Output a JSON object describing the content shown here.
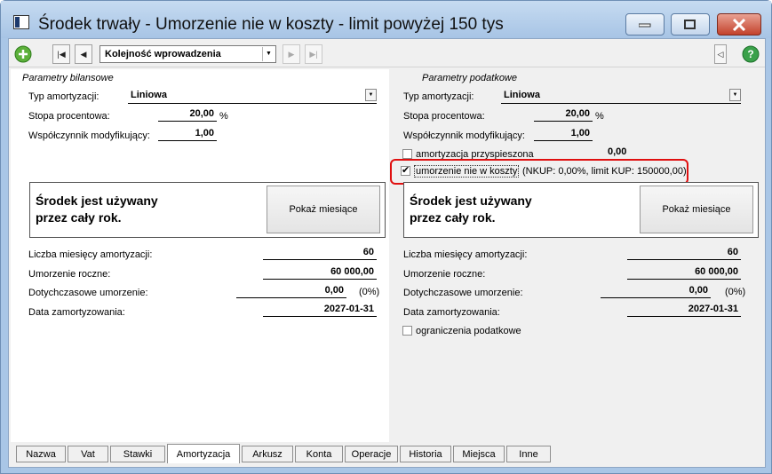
{
  "window": {
    "title": "Środek trwały - Umorzenie nie w koszty - limit powyżej 150 tys"
  },
  "toolbar": {
    "order_select": "Kolejność wprowadzenia"
  },
  "bil": {
    "header": "Parametry bilansowe",
    "typ_label": "Typ amortyzacji:",
    "typ_value": "Liniowa",
    "stopa_label": "Stopa procentowa:",
    "stopa_value": "20,00",
    "stopa_unit": "%",
    "wsp_label": "Współczynnik modyfikujący:",
    "wsp_value": "1,00",
    "used_line1": "Środek jest używany",
    "used_line2": "przez cały rok.",
    "show_months": "Pokaż miesiące",
    "liczba_label": "Liczba miesięcy amortyzacji:",
    "liczba_value": "60",
    "roczne_label": "Umorzenie roczne:",
    "roczne_value": "60 000,00",
    "dotych_label": "Dotychczasowe umorzenie:",
    "dotych_value": "0,00",
    "dotych_pct": "(0%)",
    "data_label": "Data zamortyzowania:",
    "data_value": "2027-01-31"
  },
  "pod": {
    "header": "Parametry podatkowe",
    "typ_label": "Typ amortyzacji:",
    "typ_value": "Liniowa",
    "stopa_label": "Stopa procentowa:",
    "stopa_value": "20,00",
    "stopa_unit": "%",
    "wsp_label": "Współczynnik modyfikujący:",
    "wsp_value": "1,00",
    "przysp_label": "amortyzacja przyspieszona",
    "przysp_value": "0,00",
    "nkup_label": "umorzenie nie w koszty",
    "nkup_info": "(NKUP: 0,00%, limit KUP: 150000,00)",
    "used_line1": "Środek jest używany",
    "used_line2": "przez cały rok.",
    "show_months": "Pokaż miesiące",
    "liczba_label": "Liczba miesięcy amortyzacji:",
    "liczba_value": "60",
    "roczne_label": "Umorzenie roczne:",
    "roczne_value": "60 000,00",
    "dotych_label": "Dotychczasowe umorzenie:",
    "dotych_value": "0,00",
    "dotych_pct": "(0%)",
    "data_label": "Data zamortyzowania:",
    "data_value": "2027-01-31",
    "ogr_label": "ograniczenia podatkowe"
  },
  "tabs": [
    "Nazwa",
    "Vat",
    "Stawki",
    "Amortyzacja",
    "Arkusz",
    "Konta",
    "Operacje",
    "Historia",
    "Miejsca",
    "Inne"
  ],
  "active_tab": "Amortyzacja"
}
